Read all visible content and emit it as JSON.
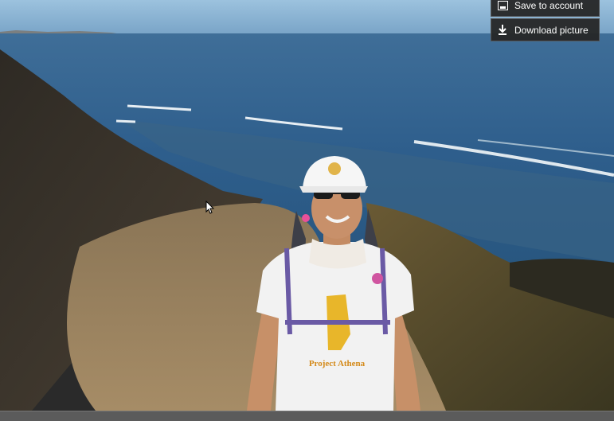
{
  "menu": {
    "save_label": "Save to account",
    "download_label": "Download picture",
    "save_icon": "save-account-icon",
    "download_icon": "download-arrow-icon"
  },
  "photo": {
    "subject": "hiker-on-coastal-trail",
    "shirt_text": "Project Athena"
  },
  "colors": {
    "menu_bg": "#262626",
    "bar_bg": "#5b5b5b",
    "ocean": "#2f5f8a",
    "sky": "#8bb6d6"
  }
}
